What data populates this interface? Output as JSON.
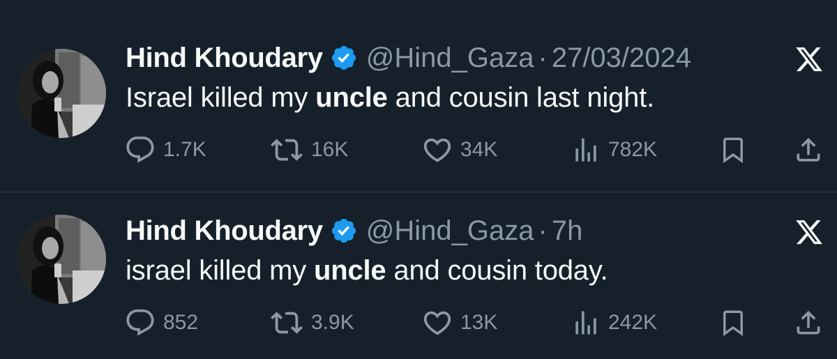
{
  "tweets": [
    {
      "author_name": "Hind Khoudary",
      "handle": "@Hind_Gaza",
      "separator": "·",
      "timestamp": "27/03/2024",
      "text_before": "Israel killed my ",
      "text_bold": "uncle",
      "text_after": " and cousin last night.",
      "replies": "1.7K",
      "reposts": "16K",
      "likes": "34K",
      "views": "782K"
    },
    {
      "author_name": "Hind Khoudary",
      "handle": "@Hind_Gaza",
      "separator": "·",
      "timestamp": "7h",
      "text_before": "israel killed my ",
      "text_bold": "uncle",
      "text_after": " and cousin today.",
      "replies": "852",
      "reposts": "3.9K",
      "likes": "13K",
      "views": "242K"
    }
  ],
  "colors": {
    "background": "#15202b",
    "primary_text": "#f7f9f9",
    "secondary_text": "#8b98a5",
    "verified_badge": "#1d9bf0",
    "divider": "#2f3b47"
  },
  "icons": [
    "verified-badge-icon",
    "x-logo-icon",
    "reply-icon",
    "repost-icon",
    "like-icon",
    "views-icon",
    "bookmark-icon",
    "share-icon"
  ]
}
